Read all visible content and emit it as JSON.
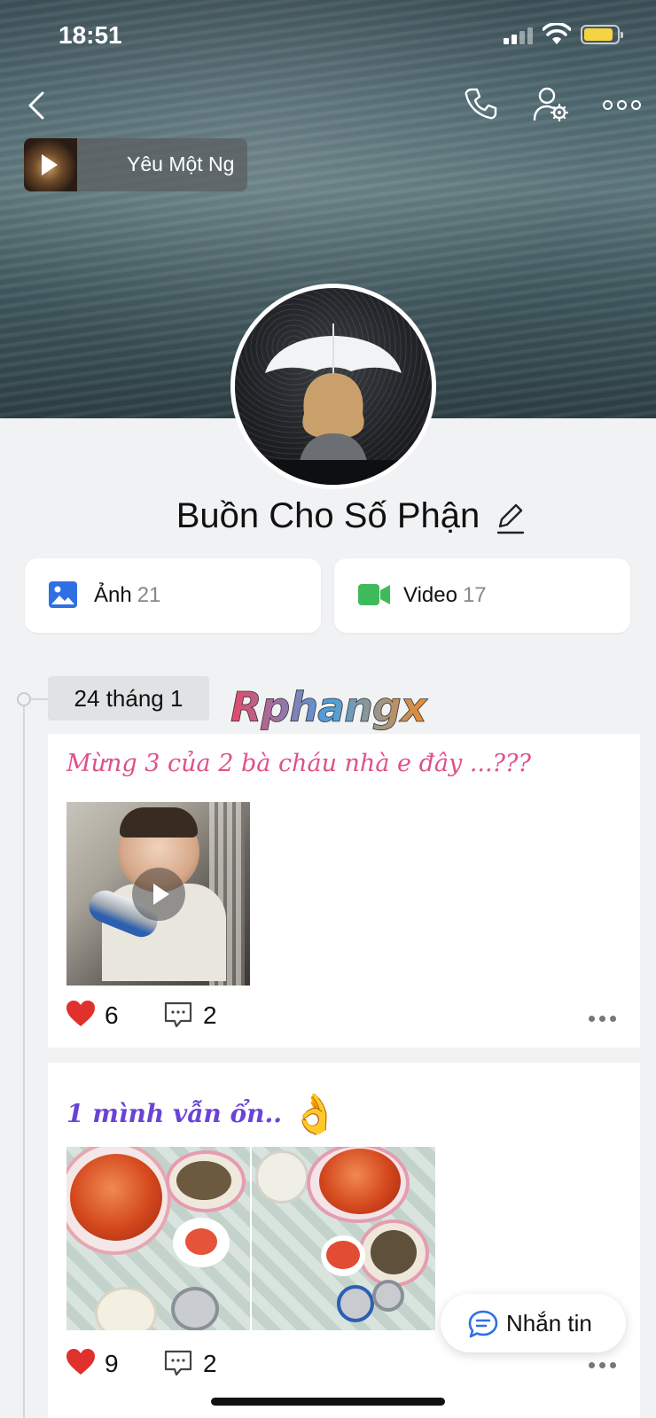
{
  "status": {
    "time": "18:51"
  },
  "music": {
    "title": "Yêu Một Ng"
  },
  "profile": {
    "name": "Buồn Cho Số Phận"
  },
  "media": {
    "photos": {
      "label": "Ảnh",
      "count": "21"
    },
    "videos": {
      "label": "Video",
      "count": "17"
    }
  },
  "timeline": {
    "date": "24 tháng 1",
    "watermark": "Rphangx",
    "posts": [
      {
        "caption": "Mừng 3 của 2 bà cháu nhà e đây ...???",
        "likes": "6",
        "comments": "2"
      },
      {
        "caption": "1 mình vẫn ổn..",
        "emoji": "👌",
        "likes": "9",
        "comments": "2"
      }
    ]
  },
  "actions": {
    "message_label": "Nhắn tin"
  },
  "colors": {
    "accent_blue": "#2f6fe4",
    "video_green": "#3fba5a",
    "heart_red": "#e0312c",
    "caption_pink": "#e0508a",
    "caption_purple": "#6a43d6"
  }
}
